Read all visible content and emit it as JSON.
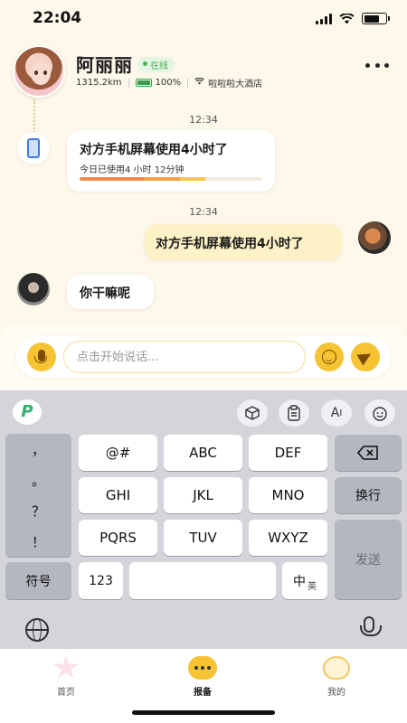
{
  "status_bar": {
    "time": "22:04"
  },
  "header": {
    "name": "阿丽丽",
    "status": "在线",
    "distance": "1315.2km",
    "battery": "100%",
    "location": "啦啦啦大酒店"
  },
  "chat": {
    "timestamp_1": "12:34",
    "report": {
      "title": "对方手机屏幕使用4小时了",
      "subtitle": "今日已使用4 小时 12分钟"
    },
    "timestamp_2": "12:34",
    "sent_message": "对方手机屏幕使用4小时了",
    "received_message": "你干嘛呢"
  },
  "input": {
    "placeholder": "点击开始说话..."
  },
  "keyboard": {
    "punctuation": [
      "，",
      "。",
      "？",
      "！"
    ],
    "rows": [
      [
        "@#",
        "ABC",
        "DEF"
      ],
      [
        "GHI",
        "JKL",
        "MNO"
      ],
      [
        "PQRS",
        "TUV",
        "WXYZ"
      ]
    ],
    "delete_label": "⌫",
    "newline_label": "换行",
    "send_label": "发送",
    "symbols_label": "符号",
    "numbers_label": "123",
    "space_label": "",
    "lang_main": "中",
    "lang_sub": "英",
    "toolbar": {
      "logo": "P",
      "tool_ai": "A",
      "tool_ai_sub": "I"
    }
  },
  "tabbar": {
    "tabs": [
      {
        "label": "首页",
        "active": false
      },
      {
        "label": "报备",
        "active": true
      },
      {
        "label": "我的",
        "active": false
      }
    ]
  },
  "colors": {
    "accent": "#f5c333",
    "online": "#4caf50",
    "background": "#fdf8ea"
  }
}
